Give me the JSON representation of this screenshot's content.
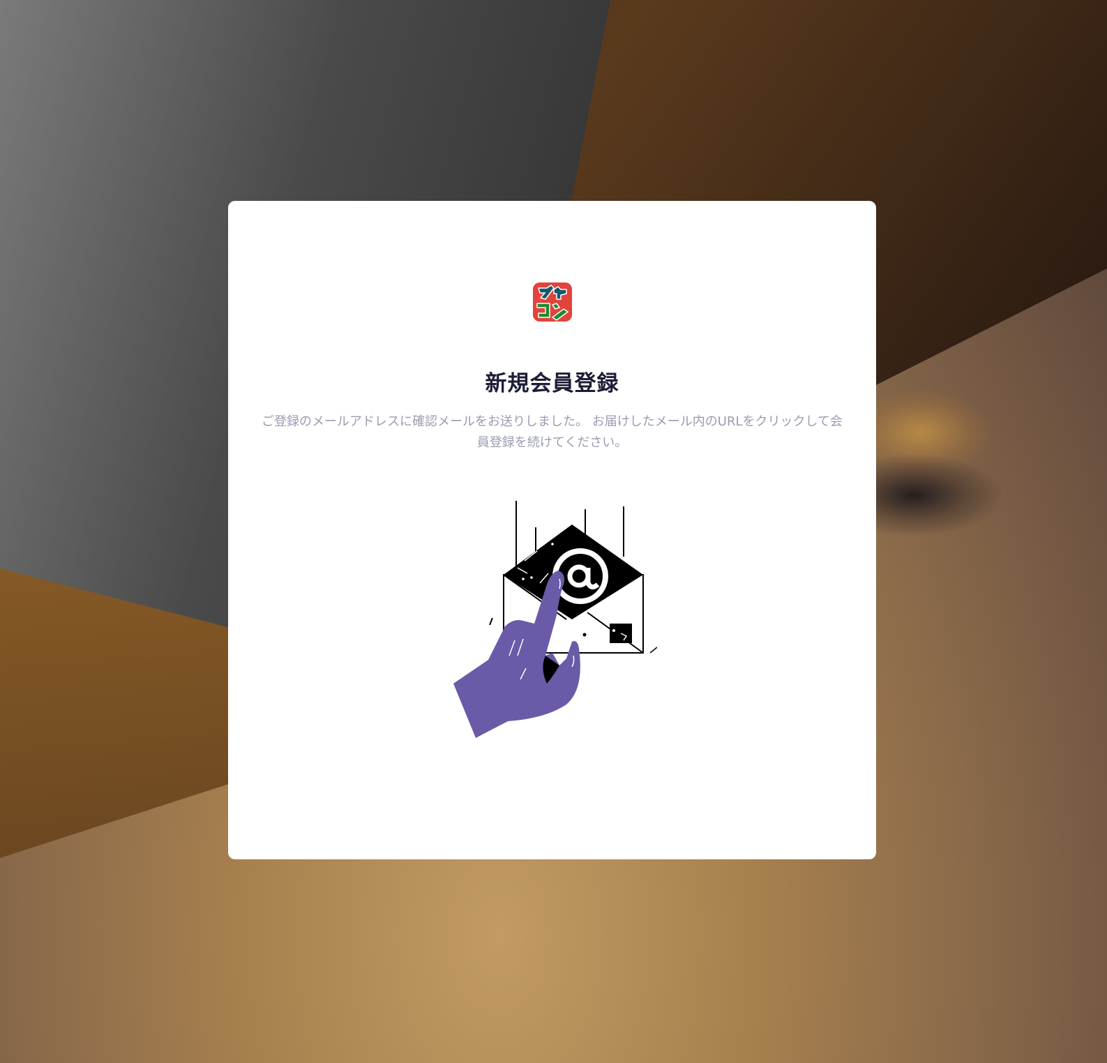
{
  "background": {
    "description_colors": [
      "#7a7a7a",
      "#2f2f2f",
      "#5a3a1d",
      "#c29a62",
      "#8e6028"
    ]
  },
  "card": {
    "logo": {
      "icon": "app-logo",
      "colors": {
        "background": "#e2433c",
        "mark_teal": "#145a6e",
        "mark_green": "#1d8b2e"
      }
    },
    "title": "新規会員登録",
    "message": "ご登録のメールアドレスに確認メールをお送りしました。 お届けしたメール内のURLをクリックして会員登録を続けてください。",
    "illustration": {
      "icon": "email-click-illustration",
      "colors": {
        "hand": "#6a5aa8",
        "envelope_fill": "#ffffff",
        "ink": "#000000"
      }
    }
  }
}
